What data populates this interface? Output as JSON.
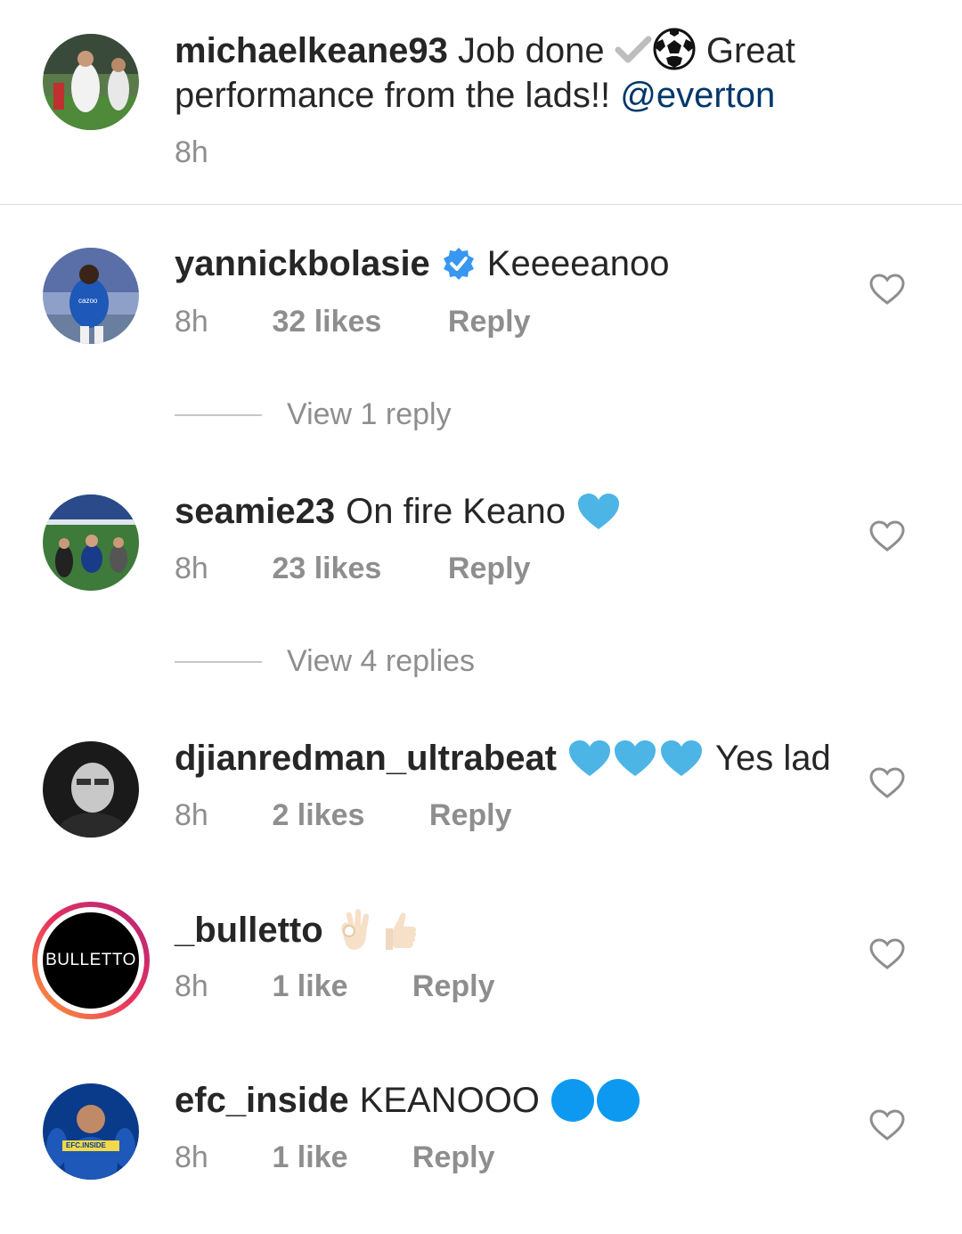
{
  "caption": {
    "username": "michaelkeane93",
    "text_part1": "Job done",
    "text_part2": "Great performance from the lads!!",
    "mention": "@everton",
    "time": "8h"
  },
  "comments": [
    {
      "username": "yannickbolasie",
      "verified": true,
      "text": "Keeeeanoo",
      "time": "8h",
      "likes": "32 likes",
      "reply_label": "Reply",
      "view_replies": "View 1 reply"
    },
    {
      "username": "seamie23",
      "text": "On fire Keano",
      "time": "8h",
      "likes": "23 likes",
      "reply_label": "Reply",
      "view_replies": "View 4 replies"
    },
    {
      "username": "djianredman_ultrabeat",
      "text": "Yes lad",
      "time": "8h",
      "likes": "2 likes",
      "reply_label": "Reply"
    },
    {
      "username": "_bulletto",
      "avatar_text": "BULLETTO",
      "text": "",
      "time": "8h",
      "likes": "1 like",
      "reply_label": "Reply"
    },
    {
      "username": "efc_inside",
      "avatar_text": "EFC.INSIDE",
      "text": "KEANOOO",
      "time": "8h",
      "likes": "1 like",
      "reply_label": "Reply"
    }
  ],
  "colors": {
    "link": "#00376b",
    "blue_heart": "#4cb5e6",
    "blue_circle": "#0d99f0",
    "verified": "#3897f0",
    "meta_gray": "#8e8e8e"
  },
  "icons": [
    "check-mark-icon",
    "soccer-ball-icon",
    "verified-badge-icon",
    "blue-heart-icon",
    "ok-hand-icon",
    "thumbs-up-icon",
    "blue-circle-icon",
    "like-heart-icon"
  ]
}
